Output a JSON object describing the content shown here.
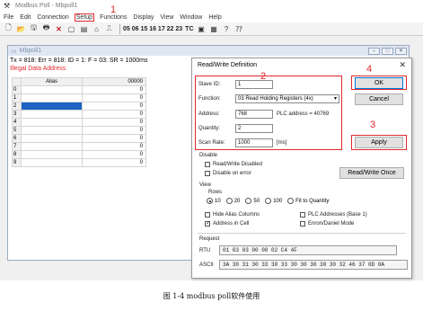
{
  "window": {
    "title": "Modbus Poll - Mbpoll1"
  },
  "menu": [
    "File",
    "Edit",
    "Connection",
    "Setup",
    "Functions",
    "Display",
    "View",
    "Window",
    "Help"
  ],
  "toolbar": {
    "numbers": "05 06 15 16 17 22 23",
    "tc_label": "TC"
  },
  "annotations": {
    "n1": "1",
    "n2": "2",
    "n3": "3",
    "n4": "4"
  },
  "child": {
    "title": "Mbpoll1",
    "status": "Tx = 818: Err = 818: ID = 1: F = 03: SR = 1000ms",
    "error": "Illegal Data Address",
    "grid": {
      "col_alias": "Alias",
      "col_value": "00000",
      "rows": [
        {
          "index": "0",
          "value": "0"
        },
        {
          "index": "1",
          "value": "0"
        },
        {
          "index": "2",
          "value": "0"
        },
        {
          "index": "3",
          "value": "0"
        },
        {
          "index": "4",
          "value": "0"
        },
        {
          "index": "5",
          "value": "0"
        },
        {
          "index": "6",
          "value": "0"
        },
        {
          "index": "7",
          "value": "0"
        },
        {
          "index": "8",
          "value": "0"
        },
        {
          "index": "9",
          "value": "0"
        }
      ]
    }
  },
  "dialog": {
    "title": "Read/Write Definition",
    "slave_id_label": "Slave ID:",
    "slave_id": "1",
    "function_label": "Function:",
    "function": "03 Read Holding Registers (4x)",
    "address_label": "Address:",
    "address": "768",
    "plc_address": "PLC address = 40769",
    "quantity_label": "Quantity:",
    "quantity": "2",
    "scan_rate_label": "Scan Rate:",
    "scan_rate": "1000",
    "scan_unit": "[ms]",
    "ok": "OK",
    "cancel": "Cancel",
    "apply": "Apply",
    "disable_label": "Disable",
    "disable_rw": "Read/Write Disabled",
    "disable_error": "Disable on error",
    "rw_once": "Read/Write Once",
    "view_label": "View",
    "rows_label": "Rows",
    "rows_options": [
      "10",
      "20",
      "50",
      "100",
      "Fit to Quantity"
    ],
    "hide_alias": "Hide Alias Columns",
    "plc_addresses": "PLC Addresses (Base 1)",
    "address_in_cell": "Address in Cell",
    "enron": "Enron/Daniel Mode",
    "request_label": "Request",
    "rtu_label": "RTU",
    "rtu_value": "01 03 03 00 00 02 C4 4F",
    "ascii_label": "ASCII",
    "ascii_value": "3A 30 31 30 33 30 33 30 30 30 30 30 32 46 37 0D 0A"
  },
  "caption": "图  1-4 modbus poll软件使用"
}
